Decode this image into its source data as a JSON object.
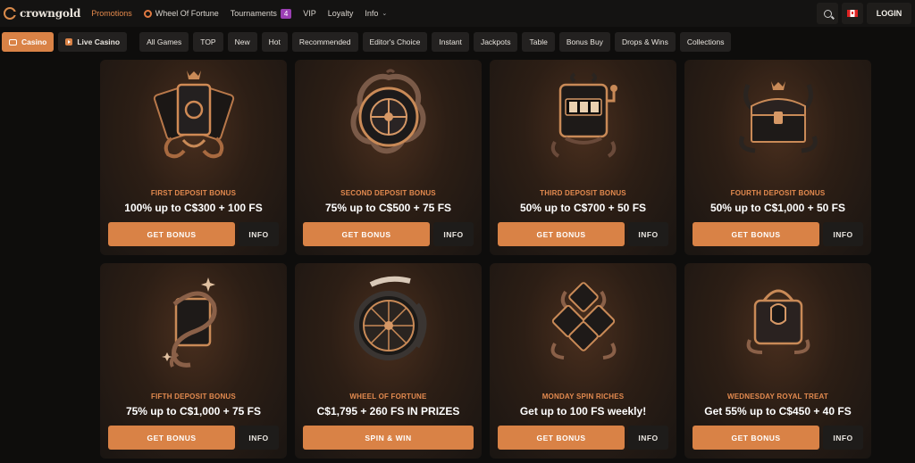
{
  "brand": {
    "name": "crowngold"
  },
  "nav": {
    "promotions": "Promotions",
    "wheel": "Wheel Of Fortune",
    "tournaments": "Tournaments",
    "tournaments_count": "4",
    "vip": "VIP",
    "loyalty": "Loyalty",
    "info": "Info"
  },
  "header": {
    "login": "LOGIN"
  },
  "categories": {
    "casino": "Casino",
    "live_casino": "Live Casino",
    "items": [
      "All Games",
      "TOP",
      "New",
      "Hot",
      "Recommended",
      "Editor's Choice",
      "Instant",
      "Jackpots",
      "Table",
      "Bonus Buy",
      "Drops & Wins",
      "Collections"
    ]
  },
  "cards": [
    {
      "label": "FIRST DEPOSIT BONUS",
      "title": "100% up to C$300 + 100 FS",
      "cta": "GET BONUS",
      "info": "INFO"
    },
    {
      "label": "SECOND DEPOSIT BONUS",
      "title": "75% up to C$500 + 75 FS",
      "cta": "GET BONUS",
      "info": "INFO"
    },
    {
      "label": "THIRD DEPOSIT BONUS",
      "title": "50% up to C$700 + 50 FS",
      "cta": "GET BONUS",
      "info": "INFO"
    },
    {
      "label": "FOURTH DEPOSIT BONUS",
      "title": "50% up to C$1,000 + 50 FS",
      "cta": "GET BONUS",
      "info": "INFO"
    },
    {
      "label": "FIFTH DEPOSIT BONUS",
      "title": "75% up to C$1,000 + 75 FS",
      "cta": "GET BONUS",
      "info": "INFO"
    },
    {
      "label": "WHEEL OF FORTUNE",
      "title": "C$1,795 + 260 FS IN PRIZES",
      "cta": "SPIN & WIN"
    },
    {
      "label": "MONDAY SPIN RICHES",
      "title": "Get up to 100 FS weekly!",
      "cta": "GET BONUS",
      "info": "INFO"
    },
    {
      "label": "WEDNESDAY ROYAL TREAT",
      "title": "Get 55% up to C$450 + 40 FS",
      "cta": "GET BONUS",
      "info": "INFO"
    }
  ],
  "colors": {
    "accent": "#d98246",
    "label": "#e38a4f",
    "tournament_badge": "#9b3fb3"
  }
}
